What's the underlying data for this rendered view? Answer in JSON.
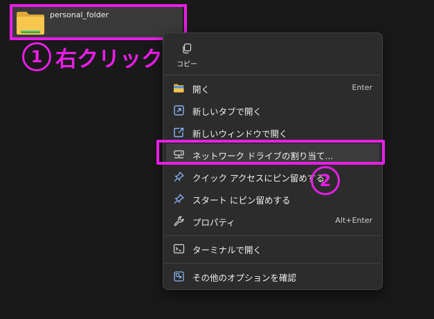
{
  "folder": {
    "name": "personal_folder"
  },
  "annotations": {
    "step1_number": "1",
    "step1_text": "右クリック",
    "step2_number": "2",
    "accent_color": "#e91ee8"
  },
  "menu": {
    "copy_label": "コピー",
    "items": [
      {
        "label": "開く",
        "shortcut": "Enter",
        "icon": "folder-icon"
      },
      {
        "label": "新しいタブで開く",
        "shortcut": "",
        "icon": "new-tab-icon"
      },
      {
        "label": "新しいウィンドウで開く",
        "shortcut": "",
        "icon": "new-window-icon"
      },
      {
        "label": "ネットワーク ドライブの割り当て...",
        "shortcut": "",
        "icon": "network-drive-icon"
      },
      {
        "label": "クイック アクセスにピン留めする",
        "shortcut": "",
        "icon": "pin-icon"
      },
      {
        "label": "スタート にピン留めする",
        "shortcut": "",
        "icon": "pin-icon"
      },
      {
        "label": "プロパティ",
        "shortcut": "Alt+Enter",
        "icon": "wrench-icon"
      },
      {
        "label": "ターミナルで開く",
        "shortcut": "",
        "icon": "terminal-icon"
      },
      {
        "label": "その他のオプションを確認",
        "shortcut": "",
        "icon": "more-options-icon"
      }
    ]
  }
}
